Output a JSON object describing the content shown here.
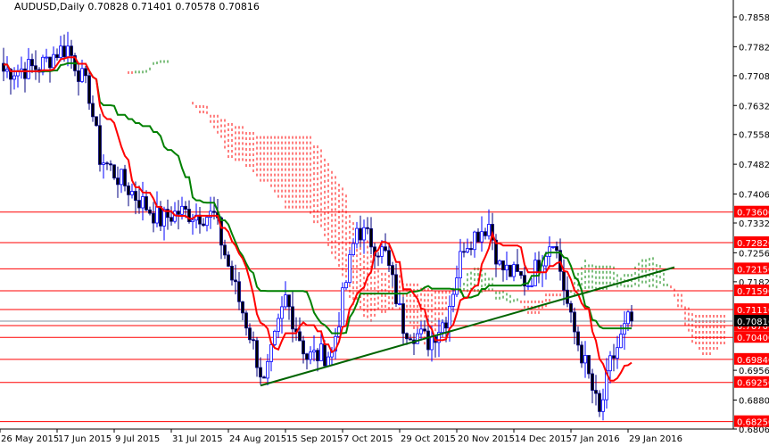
{
  "header": {
    "symbol": "AUDUSD,Daily",
    "open": "0.70828",
    "high": "0.71401",
    "low": "0.70578",
    "close": "0.70816"
  },
  "chart_data": {
    "type": "candlestick",
    "title": "AUDUSD,Daily",
    "ylim": [
      0.6806,
      0.7858
    ],
    "y_ticks": [
      "0.78580",
      "0.77820",
      "0.77080",
      "0.76320",
      "0.75580",
      "0.74820",
      "0.74060",
      "0.73320",
      "0.72560",
      "0.71820",
      "0.69560",
      "0.68800",
      "0.68060"
    ],
    "x_ticks": [
      {
        "bar": -1,
        "label": "26 May 2015"
      },
      {
        "bar": 15,
        "label": "17 Jun 2015"
      },
      {
        "bar": 31,
        "label": "9 Jul 2015"
      },
      {
        "bar": 47,
        "label": "31 Jul 2015"
      },
      {
        "bar": 63,
        "label": "24 Aug 2015"
      },
      {
        "bar": 79,
        "label": "15 Sep 2015"
      },
      {
        "bar": 95,
        "label": "7 Oct 2015"
      },
      {
        "bar": 111,
        "label": "29 Oct 2015"
      },
      {
        "bar": 127,
        "label": "20 Nov 2015"
      },
      {
        "bar": 143,
        "label": "14 Dec 2015"
      },
      {
        "bar": 159,
        "label": "7 Jan 2016"
      },
      {
        "bar": 175,
        "label": "29 Jan 2016"
      }
    ],
    "close_path": [
      [
        0,
        0.772
      ],
      [
        10,
        0.773
      ],
      [
        15,
        0.777
      ],
      [
        18,
        0.778
      ],
      [
        24,
        0.766
      ],
      [
        27,
        0.75
      ],
      [
        37,
        0.74
      ],
      [
        44,
        0.734
      ],
      [
        49,
        0.736
      ],
      [
        59,
        0.735
      ],
      [
        64,
        0.719
      ],
      [
        69,
        0.705
      ],
      [
        73,
        0.692
      ],
      [
        79,
        0.714
      ],
      [
        85,
        0.699
      ],
      [
        92,
        0.7
      ],
      [
        99,
        0.732
      ],
      [
        107,
        0.725
      ],
      [
        112,
        0.707
      ],
      [
        119,
        0.703
      ],
      [
        124,
        0.709
      ],
      [
        129,
        0.728
      ],
      [
        136,
        0.733
      ],
      [
        139,
        0.722
      ],
      [
        147,
        0.718
      ],
      [
        154,
        0.73
      ],
      [
        159,
        0.708
      ],
      [
        163,
        0.697
      ],
      [
        167,
        0.684
      ],
      [
        170,
        0.697
      ],
      [
        175,
        0.708
      ],
      [
        176,
        0.70816
      ]
    ],
    "levels": [
      {
        "price": 0.736,
        "label": "0.73600"
      },
      {
        "price": 0.7282,
        "label": "0.72820"
      },
      {
        "price": 0.7215,
        "label": "0.72150"
      },
      {
        "price": 0.7159,
        "label": "0.71590"
      },
      {
        "price": 0.7111,
        "label": "0.71110"
      },
      {
        "price": 0.707,
        "label": "0.70700"
      },
      {
        "price": 0.704,
        "label": "0.70400"
      },
      {
        "price": 0.6984,
        "label": "0.69840"
      },
      {
        "price": 0.6925,
        "label": "0.69250"
      },
      {
        "price": 0.6825,
        "label": "0.68250"
      }
    ],
    "current_price": {
      "price": 0.70816,
      "label": "0.70816"
    },
    "trendline": {
      "from": [
        72,
        0.6917
      ],
      "to": [
        188,
        0.7219
      ]
    },
    "colors": {
      "level": "#ff0000",
      "tenkan": "#ff0000",
      "kijun": "#008000",
      "trend": "#006400",
      "candle": "#000080",
      "bull_candle": "#0000ff"
    }
  }
}
